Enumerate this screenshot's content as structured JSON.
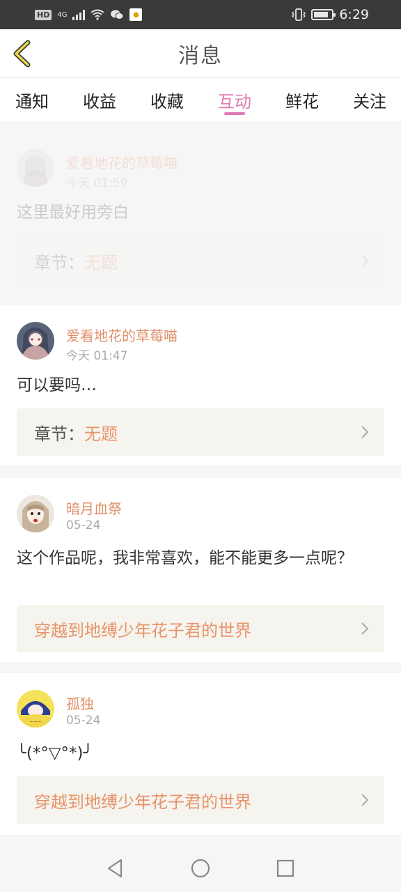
{
  "status_bar": {
    "hd": "HD",
    "network": "4G",
    "time": "6:29"
  },
  "header": {
    "title": "消息"
  },
  "tabs": [
    {
      "label": "通知",
      "active": false
    },
    {
      "label": "收益",
      "active": false
    },
    {
      "label": "收藏",
      "active": false
    },
    {
      "label": "互动",
      "active": true
    },
    {
      "label": "鲜花",
      "active": false
    },
    {
      "label": "关注",
      "active": false
    }
  ],
  "messages": [
    {
      "username": "爱看地花的草莓喵",
      "time": "今天 01:59",
      "text": "这里最好用旁白",
      "ref_key": "章节：",
      "ref_value": "无题"
    },
    {
      "username": "爱看地花的草莓喵",
      "time": "今天 01:47",
      "text": "可以要吗…",
      "ref_key": "章节：",
      "ref_value": "无题"
    },
    {
      "username": "暗月血祭",
      "time": "05-24",
      "text": "这个作品呢，我非常喜欢，能不能更多一点呢？",
      "ref_key": "",
      "ref_value": "穿越到地缚少年花子君的世界"
    },
    {
      "username": "孤独",
      "time": "05-24",
      "text": "╰(*°▽°*)╯",
      "ref_key": "",
      "ref_value": "穿越到地缚少年花子君的世界"
    }
  ],
  "colors": {
    "accent_pink": "#e07bb1",
    "username_orange": "#e0916a",
    "ref_orange": "#e8946a",
    "back_chevron": "#d4c200"
  }
}
